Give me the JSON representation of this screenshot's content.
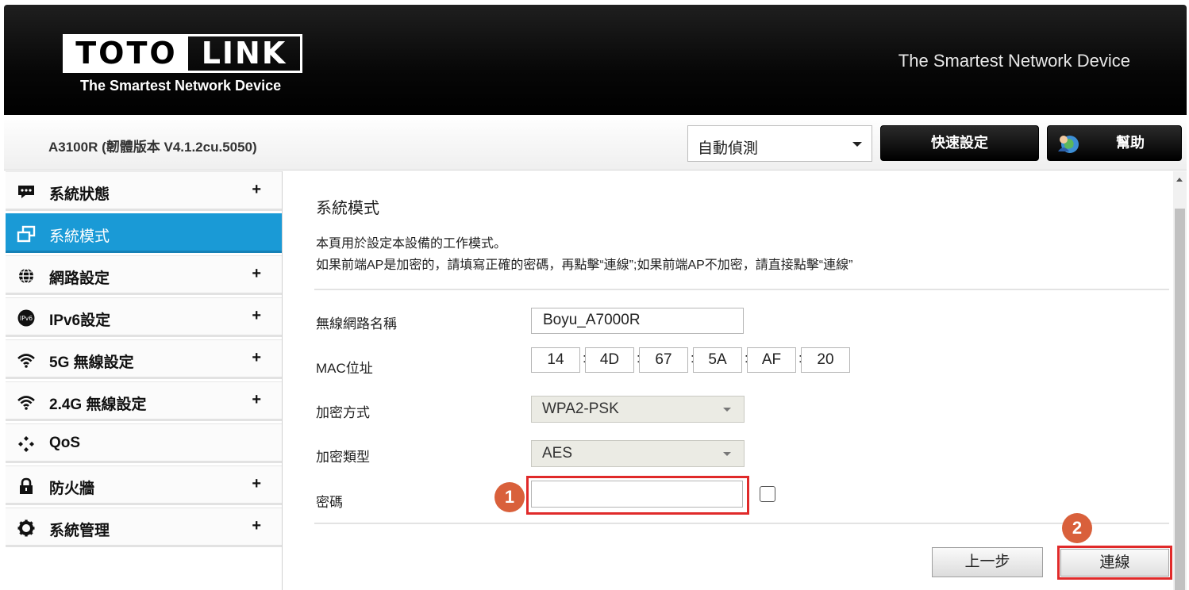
{
  "header": {
    "logo_left": "TOTO",
    "logo_right": "LINK",
    "logo_tagline": "The Smartest Network Device",
    "slogan": "The Smartest Network Device"
  },
  "toolbar": {
    "model": "A3100R (韌體版本 V4.1.2cu.5050)",
    "language_selected": "自動偵測",
    "quick_setup_label": "快速設定",
    "help_label": "幫助"
  },
  "sidebar": {
    "items": [
      {
        "label": "系統狀態",
        "icon": "chat-icon",
        "expandable": "+"
      },
      {
        "label": "系統模式",
        "icon": "windows-icon",
        "expandable": ""
      },
      {
        "label": "網路設定",
        "icon": "globe-icon",
        "expandable": "+"
      },
      {
        "label": "IPv6設定",
        "icon": "ipv6-icon",
        "expandable": "+"
      },
      {
        "label": "5G 無線設定",
        "icon": "wifi-icon",
        "expandable": "+"
      },
      {
        "label": "2.4G 無線設定",
        "icon": "wifi-icon",
        "expandable": "+"
      },
      {
        "label": "QoS",
        "icon": "diamonds-icon",
        "expandable": ""
      },
      {
        "label": "防火牆",
        "icon": "lock-icon",
        "expandable": "+"
      },
      {
        "label": "系統管理",
        "icon": "gear-icon",
        "expandable": "+"
      }
    ],
    "active_index": 1
  },
  "main": {
    "title": "系統模式",
    "desc1": "本頁用於設定本設備的工作模式。",
    "desc2": "如果前端AP是加密的，請填寫正確的密碼，再點擊“連線”;如果前端AP不加密，請直接點擊“連線”",
    "ssid_label": "無線網路名稱",
    "ssid_value": "Boyu_A7000R",
    "mac_label": "MAC位址",
    "mac": [
      "14",
      "4D",
      "67",
      "5A",
      "AF",
      "20"
    ],
    "mac_separator": ":",
    "encryption_label": "加密方式",
    "encryption_value": "WPA2-PSK",
    "cipher_label": "加密類型",
    "cipher_value": "AES",
    "password_label": "密碼",
    "password_value": "",
    "step1": "1",
    "step2": "2",
    "back_label": "上一步",
    "connect_label": "連線"
  },
  "colors": {
    "accent": "#1a9ad6",
    "highlight": "#e02a2a",
    "badge": "#d9603b"
  }
}
